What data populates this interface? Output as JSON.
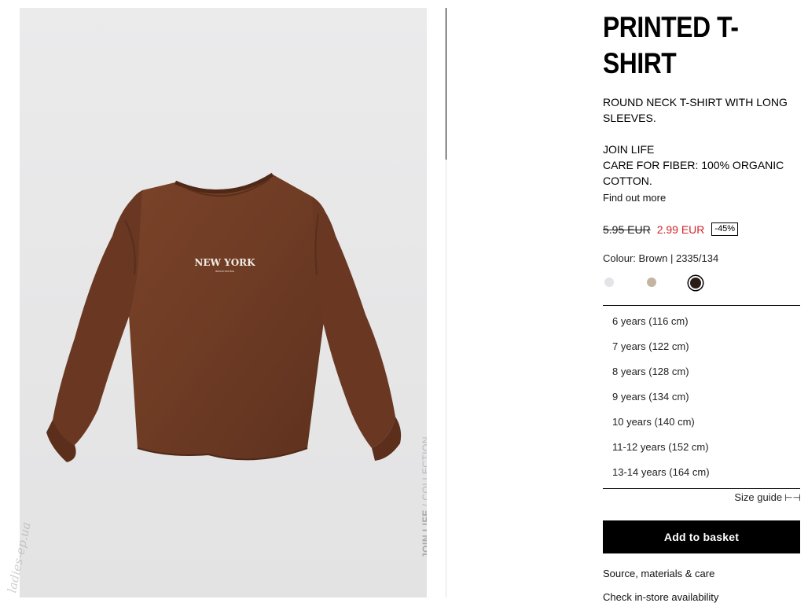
{
  "product": {
    "title": "PRINTED T-SHIRT",
    "description": "ROUND NECK T-SHIRT WITH LONG SLEEVES.",
    "join_life_label": "JOIN LIFE",
    "join_life_text": "CARE FOR FIBER: 100% ORGANIC COTTON.",
    "find_out_more": "Find out more",
    "old_price": "5.95 EUR",
    "new_price": "2.99 EUR",
    "discount": "-45%",
    "colour_line": "Colour: Brown | 2335/134",
    "print_text": "NEW YORK",
    "print_subtext": "BRAND NATURE"
  },
  "image_tag": {
    "bold": "JOIN LIFE",
    "rest": " / COLLECTION"
  },
  "watermark": "ladies-ep.ua",
  "swatches": [
    {
      "name": "light-grey",
      "color": "#e3e3ea",
      "selected": false
    },
    {
      "name": "beige",
      "color": "#c4b5a3",
      "selected": false
    },
    {
      "name": "brown",
      "color": "#2a1d16",
      "selected": true
    }
  ],
  "sizes": [
    "6 years (116 cm)",
    "7 years (122 cm)",
    "8 years (128 cm)",
    "9 years (134 cm)",
    "10 years (140 cm)",
    "11-12 years (152 cm)",
    "13-14 years (164 cm)"
  ],
  "size_guide": "Size guide",
  "add_to_basket": "Add to basket",
  "source_materials": "Source, materials & care",
  "check_store": "Check in-store availability",
  "colors": {
    "shirt": "#6e3b24",
    "sale_red": "#d0252a"
  }
}
